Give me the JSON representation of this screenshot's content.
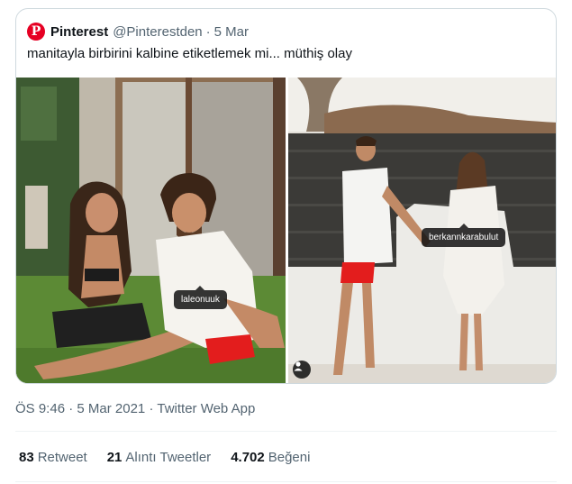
{
  "quoted_tweet": {
    "logo_glyph": "P",
    "logo_icon": "pinterest-logo-icon",
    "brand_color": "#e60023",
    "name": "Pinterest",
    "handle": "@Pinterestden",
    "separator": "·",
    "date": "5 Mar",
    "text": "manitayla birbirini kalbine etiketlemek mi... müthiş olay"
  },
  "media": {
    "left_photo": {
      "tag": "laleonuuk"
    },
    "right_photo": {
      "tag": "berkannkarabulut",
      "badge_icon": "person-tag-icon"
    }
  },
  "meta": {
    "time": "ÖS 9:46",
    "separator": "·",
    "date": "5 Mar 2021",
    "client": "Twitter Web App"
  },
  "stats": {
    "retweets": {
      "count": "83",
      "label": "Retweet"
    },
    "quotes": {
      "count": "21",
      "label": "Alıntı Tweetler"
    },
    "likes": {
      "count": "4.702",
      "label": "Beğeni"
    }
  },
  "colors": {
    "text_primary": "#0f1419",
    "text_secondary": "#536471",
    "border": "#cfd9de"
  }
}
